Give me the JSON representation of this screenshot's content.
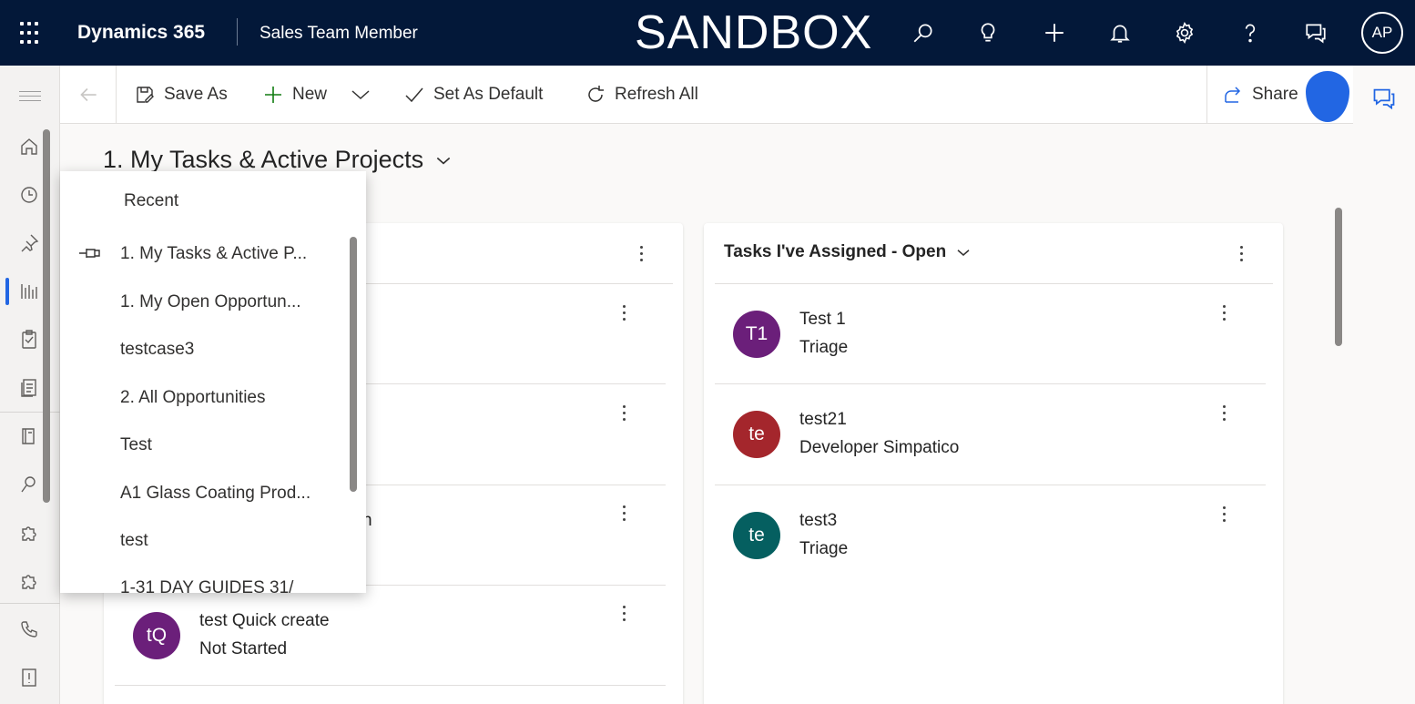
{
  "header": {
    "app_name": "Dynamics 365",
    "area_name": "Sales Team Member",
    "environment": "SANDBOX",
    "avatar_initials": "AP",
    "icons": [
      "search-icon",
      "lightbulb-icon",
      "plus-icon",
      "bell-icon",
      "gear-icon",
      "help-icon",
      "chat-icon"
    ]
  },
  "commands": {
    "save_as": "Save As",
    "new": "New",
    "set_default": "Set As Default",
    "refresh_all": "Refresh All",
    "share": "Share"
  },
  "page": {
    "title": "1. My Tasks & Active Projects"
  },
  "left_card": {
    "partial_text": "n",
    "rows": [
      {
        "title": "test Quick create",
        "subtitle": "Not Started",
        "initials": "tQ",
        "color": "#6b1f7a"
      }
    ]
  },
  "right_card": {
    "title": "Tasks I've Assigned - Open",
    "rows": [
      {
        "title": "Test 1",
        "subtitle": "Triage",
        "initials": "T1",
        "color": "#6b1f7a"
      },
      {
        "title": "test21",
        "subtitle": "Developer Simpatico",
        "initials": "te",
        "color": "#a4262c"
      },
      {
        "title": "test3",
        "subtitle": "Triage",
        "initials": "te",
        "color": "#055f60"
      }
    ]
  },
  "recent": {
    "title": "Recent",
    "items": [
      "1. My Tasks & Active P...",
      "1. My Open Opportun...",
      "testcase3",
      "2. All Opportunities",
      "Test",
      "A1 Glass Coating Prod...",
      "test",
      "1-31 DAY GUIDES 31/"
    ]
  },
  "colors": {
    "topbar": "#031839",
    "accent": "#2266e3"
  }
}
